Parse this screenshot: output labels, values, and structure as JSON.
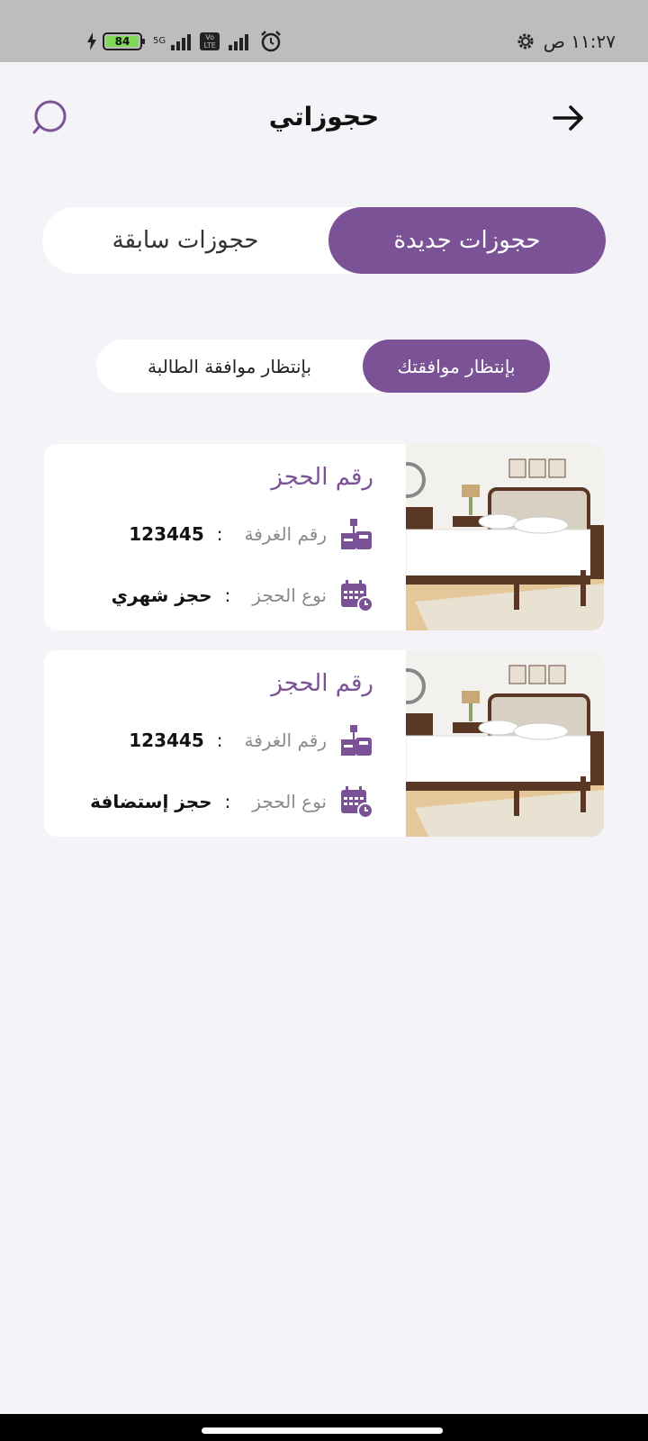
{
  "status_bar": {
    "time": "١١:٢٧ ص",
    "battery": "84",
    "network": "5G",
    "volte": "Vo LTE"
  },
  "header": {
    "title": "حجوزاتي"
  },
  "tabs": {
    "new": "حجوزات جديدة",
    "past": "حجوزات سابقة"
  },
  "subtabs": {
    "awaiting_you": "بإنتظار موافقتك",
    "awaiting_student": "بإنتظار موافقة الطالبة"
  },
  "bookings": [
    {
      "title": "رقم الحجز",
      "room_label": "رقم الغرفة",
      "room_value": "123445",
      "type_label": "نوع الحجز",
      "type_value": "حجز شهري",
      "colon": ":"
    },
    {
      "title": "رقم الحجز",
      "room_label": "رقم الغرفة",
      "room_value": "123445",
      "type_label": "نوع الحجز",
      "type_value": "حجز إستضافة",
      "colon": ":"
    }
  ],
  "colors": {
    "accent": "#7b5295",
    "background": "#f4f4f8",
    "status_bar": "#bdbdbd"
  },
  "icons": {
    "back": "arrow-right-icon",
    "search": "search-icon",
    "room": "room-furniture-icon",
    "type": "calendar-clock-icon"
  }
}
